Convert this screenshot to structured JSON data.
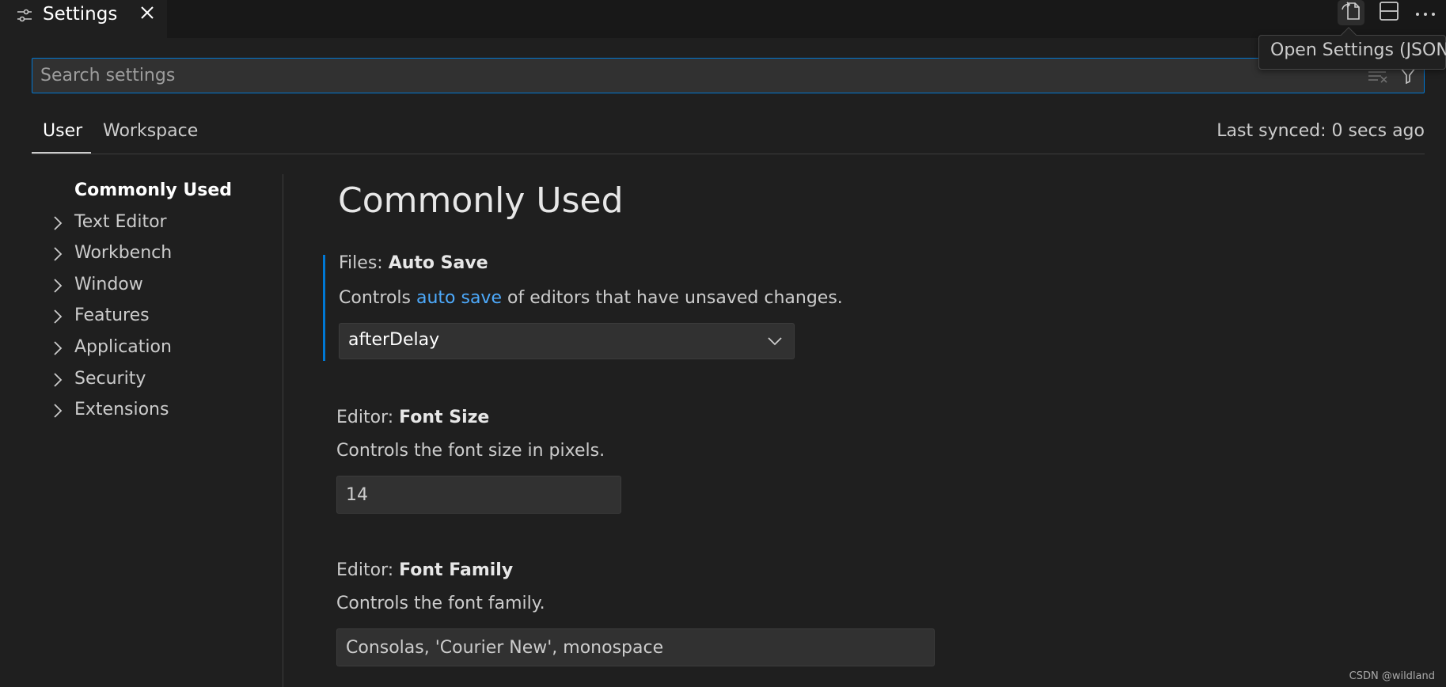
{
  "tab": {
    "label": "Settings",
    "icon": "settings-sliders-icon",
    "close_icon": "close-icon"
  },
  "actions": {
    "open_json_icon": "open-settings-json-icon",
    "split_icon": "split-editor-icon",
    "more_icon": "more-actions-icon"
  },
  "tooltip": {
    "text": "Open Settings (JSON)"
  },
  "search": {
    "placeholder": "Search settings",
    "value": ""
  },
  "scope": {
    "user": "User",
    "workspace": "Workspace",
    "synced": "Last synced: 0 secs ago"
  },
  "toc": {
    "items": [
      {
        "label": "Commonly Used"
      },
      {
        "label": "Text Editor"
      },
      {
        "label": "Workbench"
      },
      {
        "label": "Window"
      },
      {
        "label": "Features"
      },
      {
        "label": "Application"
      },
      {
        "label": "Security"
      },
      {
        "label": "Extensions"
      }
    ]
  },
  "main": {
    "section_title": "Commonly Used",
    "settings": [
      {
        "category": "Files: ",
        "name": "Auto Save",
        "desc_before": "Controls ",
        "desc_link": "auto save",
        "desc_after": " of editors that have unsaved changes.",
        "value": "afterDelay"
      },
      {
        "category": "Editor: ",
        "name": "Font Size",
        "desc": "Controls the font size in pixels.",
        "value": "14"
      },
      {
        "category": "Editor: ",
        "name": "Font Family",
        "desc": "Controls the font family.",
        "value": "Consolas, 'Courier New', monospace"
      }
    ]
  },
  "watermark": "CSDN @wildland",
  "colors": {
    "background": "#1f1f1f",
    "focus": "#0078d4",
    "link": "#4daafc"
  }
}
